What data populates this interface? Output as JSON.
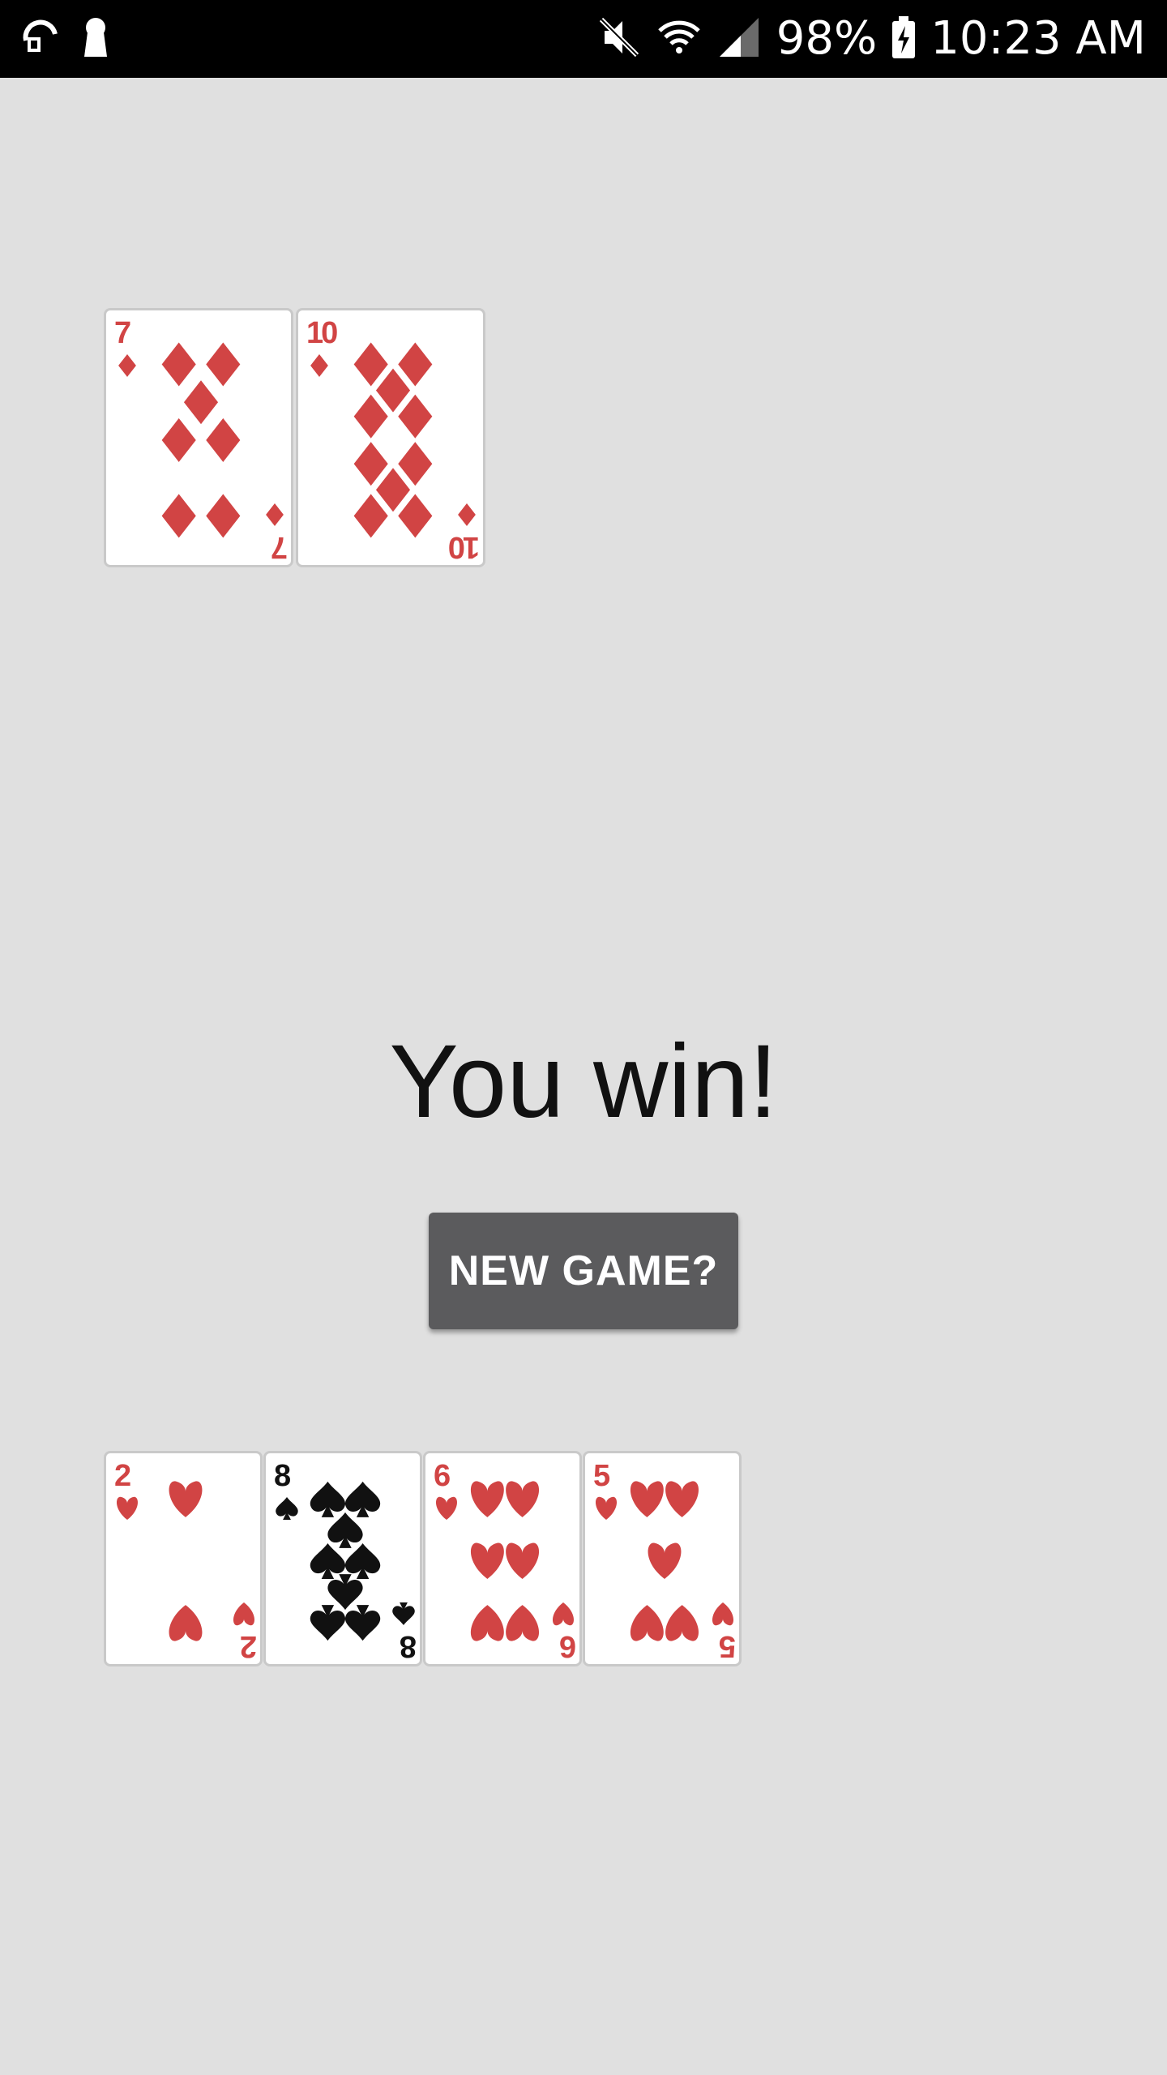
{
  "status_bar": {
    "battery_percent": "98%",
    "time": "10:23 AM",
    "icons": [
      "sync-icon",
      "keyhole-icon",
      "mute-icon",
      "wifi-icon",
      "signal-icon",
      "battery-charging-icon"
    ]
  },
  "dealer_hand": {
    "cards": [
      {
        "rank": "7",
        "suit": "diamonds",
        "color": "red"
      },
      {
        "rank": "10",
        "suit": "diamonds",
        "color": "red"
      }
    ]
  },
  "message": {
    "result": "You win!"
  },
  "actions": {
    "new_game_label": "NEW GAME?"
  },
  "player_hand": {
    "cards": [
      {
        "rank": "2",
        "suit": "hearts",
        "color": "red"
      },
      {
        "rank": "8",
        "suit": "spades",
        "color": "black"
      },
      {
        "rank": "6",
        "suit": "hearts",
        "color": "red"
      },
      {
        "rank": "5",
        "suit": "hearts",
        "color": "red"
      }
    ]
  },
  "colors": {
    "background": "#e0e0e0",
    "button": "#5b5b5d",
    "red_suit": "#d14444",
    "black_suit": "#111111"
  }
}
